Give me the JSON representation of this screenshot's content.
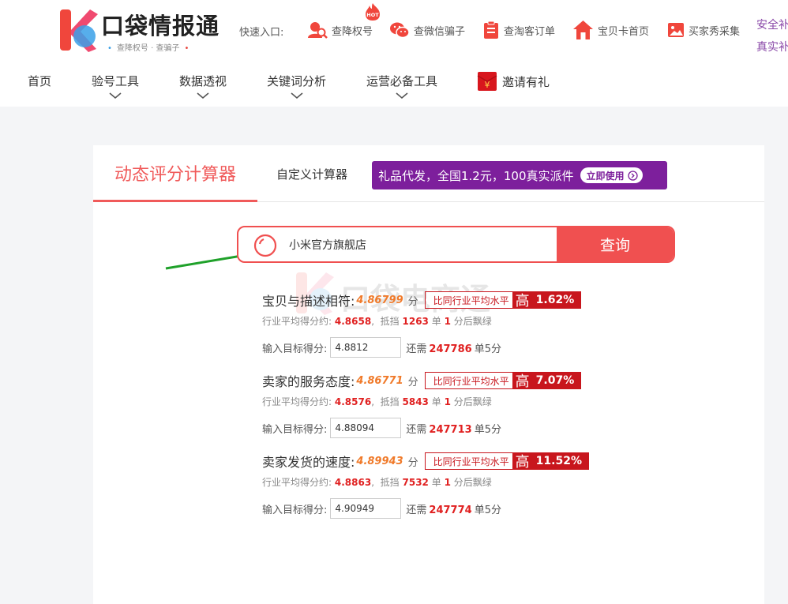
{
  "brand": {
    "name": "口袋情报通",
    "slogan_left": "查降权号",
    "slogan_sep": "·",
    "slogan_right": "查骗子",
    "hot_badge": "HOT"
  },
  "quick_entry": {
    "label": "快速入口:",
    "items": [
      {
        "label": "查降权号",
        "icon": "user-search-icon"
      },
      {
        "label": "查微信骗子",
        "icon": "wechat-icon"
      },
      {
        "label": "查淘客订单",
        "icon": "clipboard-icon"
      },
      {
        "label": "宝贝卡首页",
        "icon": "home-icon"
      },
      {
        "label": "买家秀采集",
        "icon": "image-icon"
      }
    ]
  },
  "side_links": [
    "安全补",
    "真实补"
  ],
  "nav": {
    "items": [
      {
        "label": "首页",
        "has_dropdown": false
      },
      {
        "label": "验号工具",
        "has_dropdown": true
      },
      {
        "label": "数据透视",
        "has_dropdown": true
      },
      {
        "label": "关键词分析",
        "has_dropdown": true
      },
      {
        "label": "运营必备工具",
        "has_dropdown": true
      }
    ],
    "invite": "邀请有礼",
    "invite_icon_char": "¥"
  },
  "tabs": {
    "active": "动态评分计算器",
    "custom": "自定义计算器"
  },
  "promo": {
    "text": "礼品代发，全国1.2元，100真实派件",
    "button": "立即使用"
  },
  "search": {
    "value": "小米官方旗舰店",
    "button": "查询"
  },
  "watermark": "口袋电商通",
  "results": [
    {
      "label": "宝贝与描述相符:",
      "score": "4.86799",
      "unit": "分",
      "compare_label": "比同行业平均水平",
      "compare_level": "高",
      "compare_pct": "1.62%",
      "avg_prefix": "行业平均得分约:",
      "avg_value": "4.8658",
      "avg_sep": ",",
      "offset_prefix": "抵挡",
      "offset_count": "1263",
      "offset_unit": "单",
      "offset_one": "1",
      "offset_suffix": "分后飘绿",
      "target_label": "输入目标得分:",
      "target_value": "4.8812",
      "need_prefix": "还需",
      "need_count": "247786",
      "need_suffix": "单5分"
    },
    {
      "label": "卖家的服务态度:",
      "score": "4.86771",
      "unit": "分",
      "compare_label": "比同行业平均水平",
      "compare_level": "高",
      "compare_pct": "7.07%",
      "avg_prefix": "行业平均得分约:",
      "avg_value": "4.8576",
      "avg_sep": ",",
      "offset_prefix": "抵挡",
      "offset_count": "5843",
      "offset_unit": "单",
      "offset_one": "1",
      "offset_suffix": "分后飘绿",
      "target_label": "输入目标得分:",
      "target_value": "4.88094",
      "need_prefix": "还需",
      "need_count": "247713",
      "need_suffix": "单5分"
    },
    {
      "label": "卖家发货的速度:",
      "score": "4.89943",
      "unit": "分",
      "compare_label": "比同行业平均水平",
      "compare_level": "高",
      "compare_pct": "11.52%",
      "avg_prefix": "行业平均得分约:",
      "avg_value": "4.8863",
      "avg_sep": ",",
      "offset_prefix": "抵挡",
      "offset_count": "7532",
      "offset_unit": "单",
      "offset_one": "1",
      "offset_suffix": "分后飘绿",
      "target_label": "输入目标得分:",
      "target_value": "4.90949",
      "need_prefix": "还需",
      "need_count": "247774",
      "need_suffix": "单5分"
    }
  ],
  "colors": {
    "accent": "#f05050",
    "promo": "#7d1f9c",
    "compare": "#c8161d",
    "score": "#f07a2a",
    "arrow": "#1fa12a"
  }
}
